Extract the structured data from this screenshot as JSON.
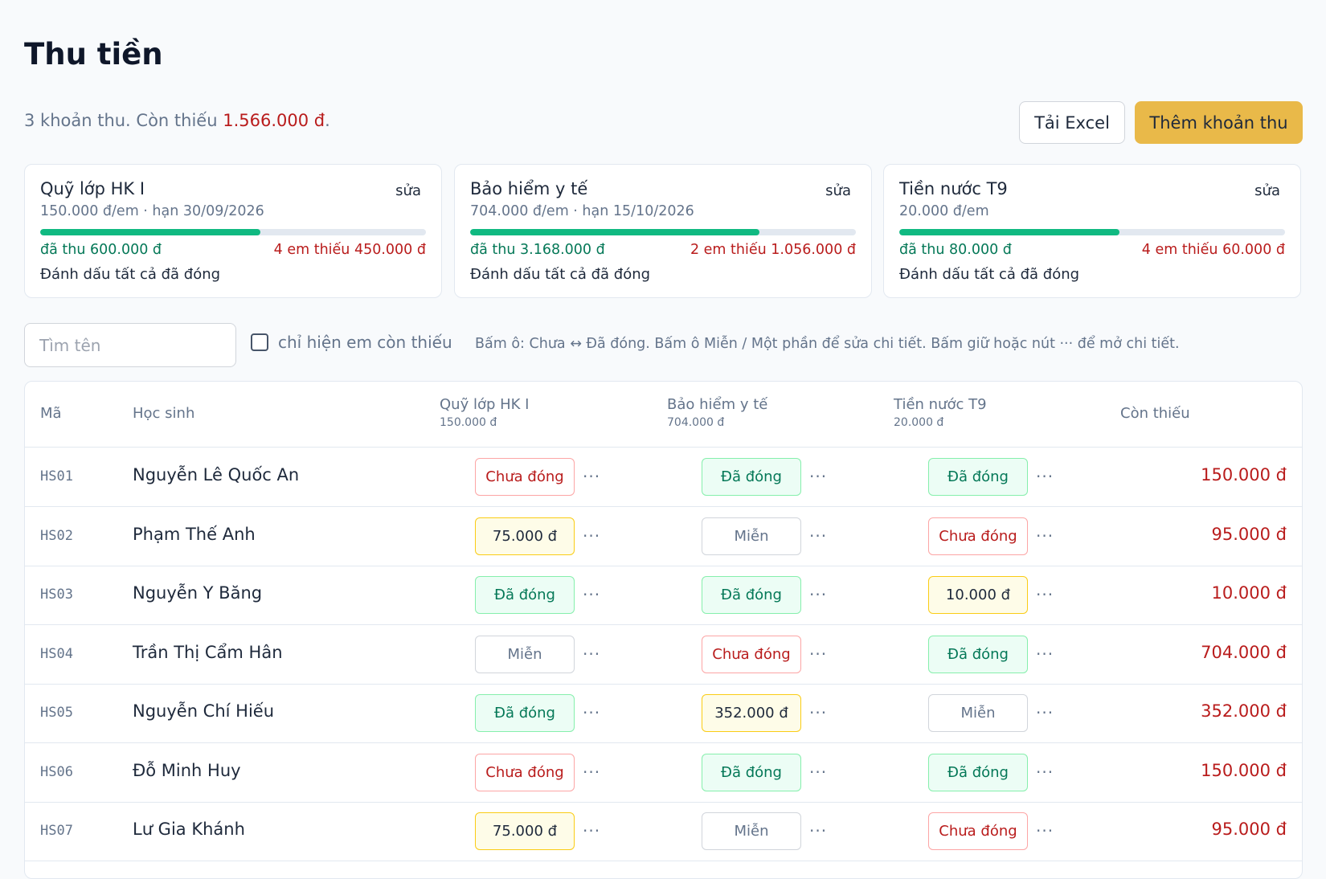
{
  "page": {
    "title": "Thu tiền",
    "summary_prefix": "3 khoản thu. Còn thiếu ",
    "summary_amount": "1.566.000 đ",
    "summary_suffix": "."
  },
  "actions": {
    "excel_label": "Tải Excel",
    "add_label": "Thêm khoản thu"
  },
  "fees": [
    {
      "name": "Quỹ lớp HK I",
      "edit_label": "sửa",
      "meta": "150.000 đ/em · hạn 30/09/2026",
      "progress": 0.57,
      "collected": "đã thu 600.000 đ",
      "missing": "4 em thiếu 450.000 đ",
      "mark_all": "Đánh dấu tất cả đã đóng"
    },
    {
      "name": "Bảo hiểm y tế",
      "edit_label": "sửa",
      "meta": "704.000 đ/em · hạn 15/10/2026",
      "progress": 0.75,
      "collected": "đã thu 3.168.000 đ",
      "missing": "2 em thiếu 1.056.000 đ",
      "mark_all": "Đánh dấu tất cả đã đóng"
    },
    {
      "name": "Tiền nước T9",
      "edit_label": "sửa",
      "meta": "20.000 đ/em",
      "progress": 0.57,
      "collected": "đã thu 80.000 đ",
      "missing": "4 em thiếu 60.000 đ",
      "mark_all": "Đánh dấu tất cả đã đóng"
    }
  ],
  "filters": {
    "search_placeholder": "Tìm tên",
    "only_owing_label": "chỉ hiện em còn thiếu",
    "hint": "Bấm ô: Chưa ↔ Đã đóng. Bấm ô Miễn / Một phần để sửa chi tiết. Bấm giữ hoặc nút ··· để mở chi tiết."
  },
  "table": {
    "columns": {
      "code": "Mã",
      "student": "Học sinh",
      "fee1": "Quỹ lớp HK I",
      "fee1_amount": "150.000 đ",
      "fee2": "Bảo hiểm y tế",
      "fee2_amount": "704.000 đ",
      "fee3": "Tiền nước T9",
      "fee3_amount": "20.000 đ",
      "owed": "Còn thiếu"
    },
    "more_label": "···",
    "rows": [
      {
        "code": "HS01",
        "name": "Nguyễn Lê Quốc An",
        "fees": [
          {
            "label": "Chưa đóng",
            "kind": "unpaid"
          },
          {
            "label": "Đã đóng",
            "kind": "paid"
          },
          {
            "label": "Đã đóng",
            "kind": "paid"
          }
        ],
        "owed": "150.000 đ"
      },
      {
        "code": "HS02",
        "name": "Phạm Thế Anh",
        "fees": [
          {
            "label": "75.000 đ",
            "kind": "partial"
          },
          {
            "label": "Miễn",
            "kind": "exempt"
          },
          {
            "label": "Chưa đóng",
            "kind": "unpaid"
          }
        ],
        "owed": "95.000 đ"
      },
      {
        "code": "HS03",
        "name": "Nguyễn Y Băng",
        "fees": [
          {
            "label": "Đã đóng",
            "kind": "paid"
          },
          {
            "label": "Đã đóng",
            "kind": "paid"
          },
          {
            "label": "10.000 đ",
            "kind": "partial"
          }
        ],
        "owed": "10.000 đ"
      },
      {
        "code": "HS04",
        "name": "Trần Thị Cẩm Hân",
        "fees": [
          {
            "label": "Miễn",
            "kind": "exempt"
          },
          {
            "label": "Chưa đóng",
            "kind": "unpaid"
          },
          {
            "label": "Đã đóng",
            "kind": "paid"
          }
        ],
        "owed": "704.000 đ"
      },
      {
        "code": "HS05",
        "name": "Nguyễn Chí Hiếu",
        "fees": [
          {
            "label": "Đã đóng",
            "kind": "paid"
          },
          {
            "label": "352.000 đ",
            "kind": "partial"
          },
          {
            "label": "Miễn",
            "kind": "exempt"
          }
        ],
        "owed": "352.000 đ"
      },
      {
        "code": "HS06",
        "name": "Đỗ Minh Huy",
        "fees": [
          {
            "label": "Chưa đóng",
            "kind": "unpaid"
          },
          {
            "label": "Đã đóng",
            "kind": "paid"
          },
          {
            "label": "Đã đóng",
            "kind": "paid"
          }
        ],
        "owed": "150.000 đ"
      },
      {
        "code": "HS07",
        "name": "Lư Gia Khánh",
        "fees": [
          {
            "label": "75.000 đ",
            "kind": "partial"
          },
          {
            "label": "Miễn",
            "kind": "exempt"
          },
          {
            "label": "Chưa đóng",
            "kind": "unpaid"
          }
        ],
        "owed": "95.000 đ"
      }
    ]
  }
}
